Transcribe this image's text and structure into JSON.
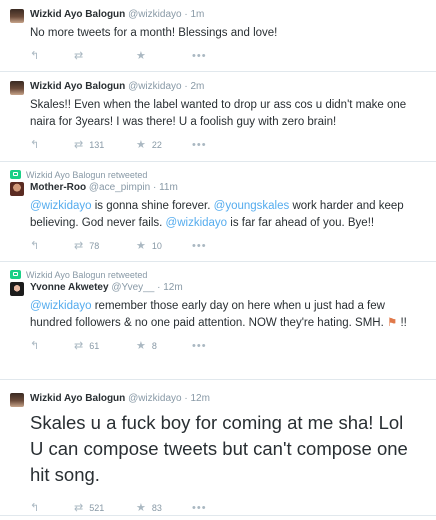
{
  "tweets": [
    {
      "fullname": "Wizkid Ayo Balogun",
      "username": "@wizkidayo",
      "dot": "·",
      "time": "1m",
      "text": "No more tweets for a month! Blessings and love!",
      "retweets": "",
      "favorites": "",
      "more": "•••"
    },
    {
      "fullname": "Wizkid Ayo Balogun",
      "username": "@wizkidayo",
      "dot": "·",
      "time": "2m",
      "text": "Skales!! Even when the label wanted to drop ur ass cos u didn't make one naira for 3years! I was there! U a foolish guy with zero brain!",
      "retweets": "131",
      "favorites": "22",
      "more": "•••"
    },
    {
      "context": "Wizkid Ayo Balogun retweeted",
      "fullname": "Mother-Roo",
      "username": "@ace_pimpin",
      "dot": "·",
      "time": "11m",
      "text_parts": {
        "m1": "@wizkidayo",
        "t1": " is gonna shine forever. ",
        "m2": "@youngskales",
        "t2": " work harder and keep believing. God never fails. ",
        "m3": "@wizkidayo",
        "t3": " is far far ahead of you. Bye!!"
      },
      "retweets": "78",
      "favorites": "10",
      "more": "•••"
    },
    {
      "context": "Wizkid Ayo Balogun retweeted",
      "fullname": "Yvonne Akwetey",
      "username": "@Yvey__",
      "dot": "·",
      "time": "12m",
      "text_parts": {
        "m1": "@wizkidayo",
        "t1": " remember those early day on here when u just had a few hundred followers & no one paid attention. NOW they're hating. SMH. ",
        "flag": "⚑",
        "t2": " !!"
      },
      "retweets": "61",
      "favorites": "8",
      "more": "•••"
    },
    {
      "fullname": "Wizkid Ayo Balogun",
      "username": "@wizkidayo",
      "dot": "·",
      "time": "12m",
      "text": "Skales u a fuck boy for coming at me sha! Lol   U can compose tweets but can't compose one hit song.",
      "retweets": "521",
      "favorites": "83",
      "more": "•••"
    }
  ],
  "icons": {
    "reply": "↰",
    "retweet": "⇄",
    "favorite": "★"
  }
}
